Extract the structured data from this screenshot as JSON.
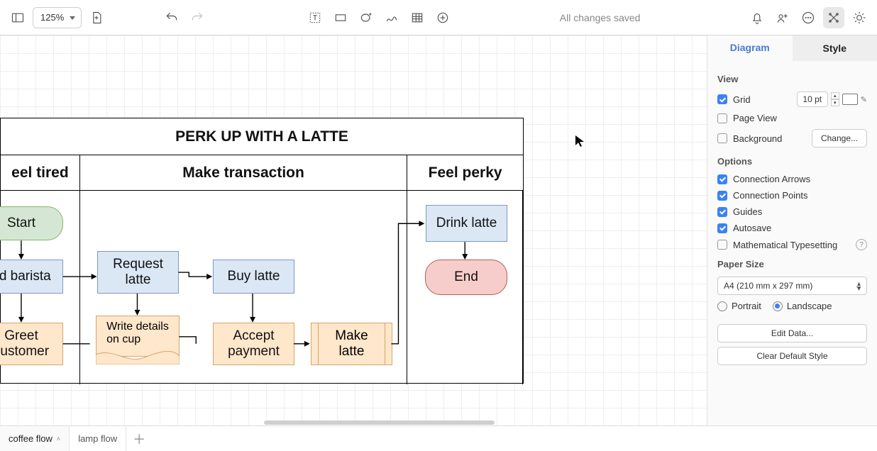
{
  "toolbar": {
    "zoom": "125%",
    "status": "All changes saved"
  },
  "panel": {
    "tabs": {
      "diagram": "Diagram",
      "style": "Style"
    },
    "view": {
      "heading": "View",
      "grid_label": "Grid",
      "grid_checked": true,
      "grid_size": "10 pt",
      "page_view_label": "Page View",
      "page_view_checked": false,
      "background_label": "Background",
      "background_checked": false,
      "change_btn": "Change..."
    },
    "options": {
      "heading": "Options",
      "arrows_label": "Connection Arrows",
      "arrows_checked": true,
      "points_label": "Connection Points",
      "points_checked": true,
      "guides_label": "Guides",
      "guides_checked": true,
      "autosave_label": "Autosave",
      "autosave_checked": true,
      "math_label": "Mathematical Typesetting",
      "math_checked": false
    },
    "paper": {
      "heading": "Paper Size",
      "size": "A4 (210 mm x 297 mm)",
      "portrait_label": "Portrait",
      "landscape_label": "Landscape",
      "orientation": "landscape"
    },
    "buttons": {
      "edit_data": "Edit Data...",
      "clear_style": "Clear Default Style"
    }
  },
  "diagram": {
    "title": "PERK UP WITH A LATTE",
    "lanes": [
      "eel tired",
      "Make transaction",
      "Feel perky"
    ],
    "start": "Start",
    "find_barista": "nd barista",
    "greet": "Greet\ncustomer",
    "request": "Request\nlatte",
    "write": "Write details\non cup",
    "buy": "Buy latte",
    "accept": "Accept\npayment",
    "make": "Make\nlatte",
    "drink": "Drink latte",
    "end": "End"
  },
  "pages": {
    "active": "coffee flow",
    "other": "lamp flow"
  }
}
